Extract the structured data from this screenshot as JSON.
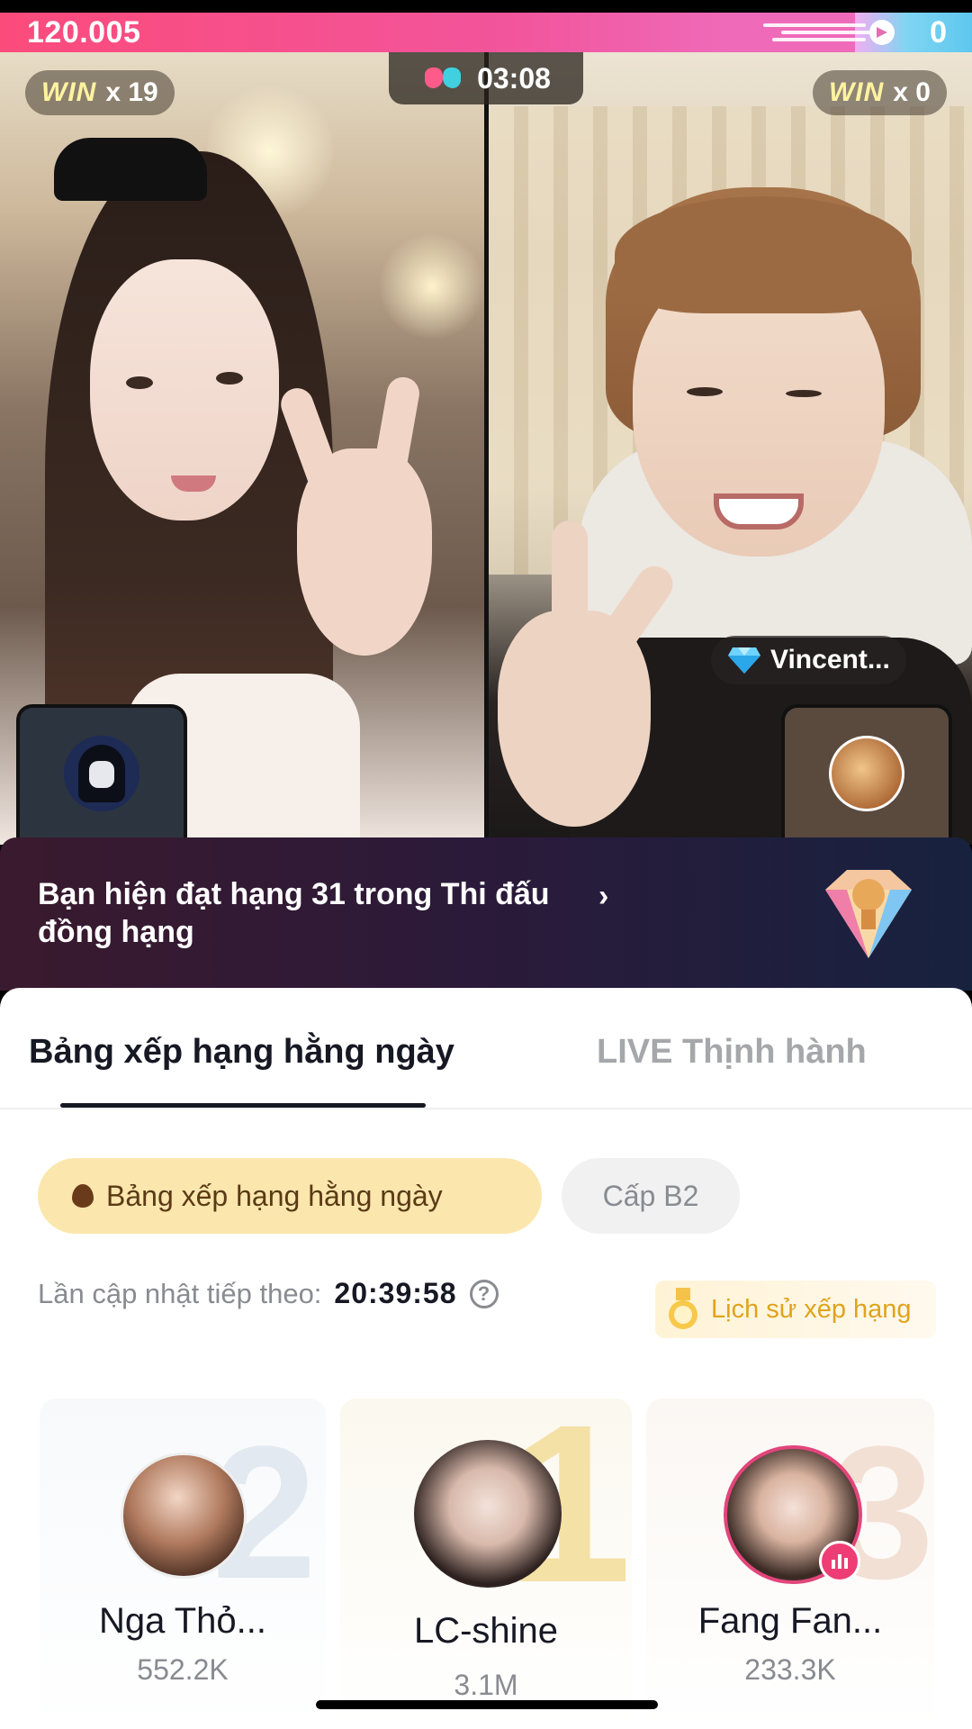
{
  "battle": {
    "left_score": "120.005",
    "right_score": "0",
    "timer": "03:08",
    "left_win_label": "WIN",
    "left_win_count": "x 19",
    "right_win_label": "WIN",
    "right_win_count": "x 0",
    "right_streamer_name": "Vincent...",
    "colors": {
      "left": "#f2559c",
      "right": "#5ec7ee"
    }
  },
  "banner": {
    "text": "Bạn hiện đạt hạng 31 trong Thi đấu đồng hạng",
    "chevron": "›"
  },
  "sheet": {
    "tabs": [
      {
        "label": "Bảng xếp hạng hằng ngày",
        "active": true
      },
      {
        "label": "LIVE Thịnh hành",
        "active": false
      }
    ],
    "chips": [
      {
        "label": "Bảng xếp hạng hằng ngày",
        "active": true
      },
      {
        "label": "Cấp B2",
        "active": false
      }
    ],
    "update_label": "Lần cập nhật tiếp theo:",
    "update_time": "20:39:58",
    "help_glyph": "?",
    "history_label": "Lịch sử xếp hạng",
    "podium": [
      {
        "rank": "2",
        "name": "Nga Thỏ...",
        "score": "552.2K"
      },
      {
        "rank": "1",
        "name": "LC-shine",
        "score": "3.1M"
      },
      {
        "rank": "3",
        "name": "Fang Fan...",
        "score": "233.3K"
      }
    ]
  },
  "icons": {
    "battle_icon": "gloves-icon",
    "diamond": "diamond-icon",
    "trophy": "trophy-gem-icon",
    "medal": "medal-icon",
    "live_badge": "live-bars-icon"
  }
}
